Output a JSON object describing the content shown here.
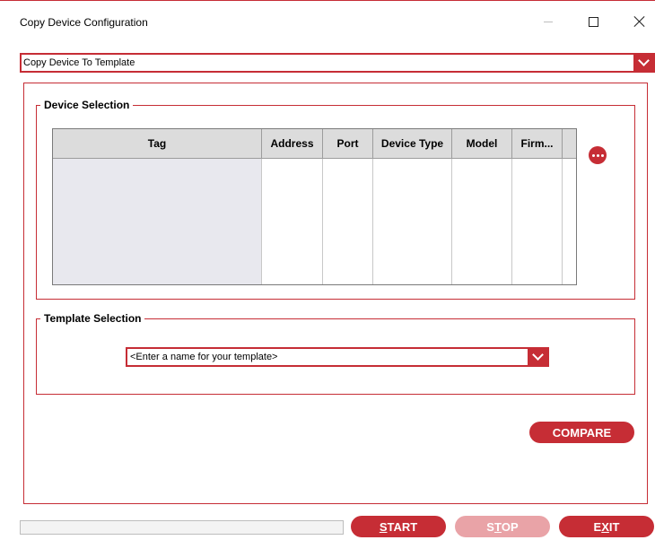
{
  "window": {
    "title": "Copy Device Configuration",
    "minimize_label": "—",
    "maximize_label": "□",
    "close_label": "✕"
  },
  "mode_selector": {
    "value": "Copy Device To Template",
    "icon": "chevron-down-icon"
  },
  "device_selection": {
    "title": "Device Selection",
    "columns": [
      "Tag",
      "Address",
      "Port",
      "Device Type",
      "Model",
      "Firm..."
    ],
    "rows": [],
    "more_button_icon": "ellipsis-icon"
  },
  "template_selection": {
    "title": "Template Selection",
    "placeholder": "<Enter a name for your template>",
    "icon": "chevron-down-icon"
  },
  "buttons": {
    "compare": "COMPARE",
    "start_mnemonic": "S",
    "start_rest": "TART",
    "stop_pre": "S",
    "stop_mnemonic": "T",
    "stop_rest": "OP",
    "exit_pre": "E",
    "exit_mnemonic": "X",
    "exit_rest": "IT"
  },
  "colors": {
    "accent": "#c62d35",
    "accent_disabled": "#e9a3a7",
    "grid_header": "#dcdcdc",
    "tag_column": "#e8e8ee"
  }
}
